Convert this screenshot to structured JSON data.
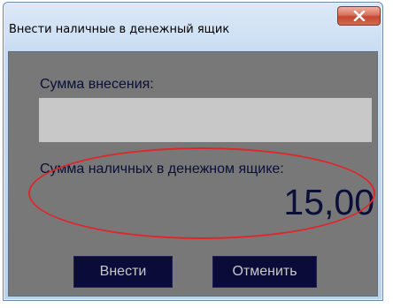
{
  "window": {
    "title": "Внести наличные в денежный ящик"
  },
  "form": {
    "amount_label": "Сумма внесения:",
    "amount_value": "",
    "drawer_label": "Сумма наличных в денежном ящике:",
    "drawer_value": "15,00"
  },
  "buttons": {
    "deposit_label": "Внести",
    "cancel_label": "Отменить"
  },
  "icons": {
    "close": "close-icon"
  },
  "colors": {
    "client_background": "#787878",
    "input_background": "#c8c8c8",
    "button_background": "#0b0b3a",
    "button_text": "#c8c8c8",
    "text": "#0a0f3a",
    "highlight": "#e0262b",
    "close_button": "#c34630"
  }
}
